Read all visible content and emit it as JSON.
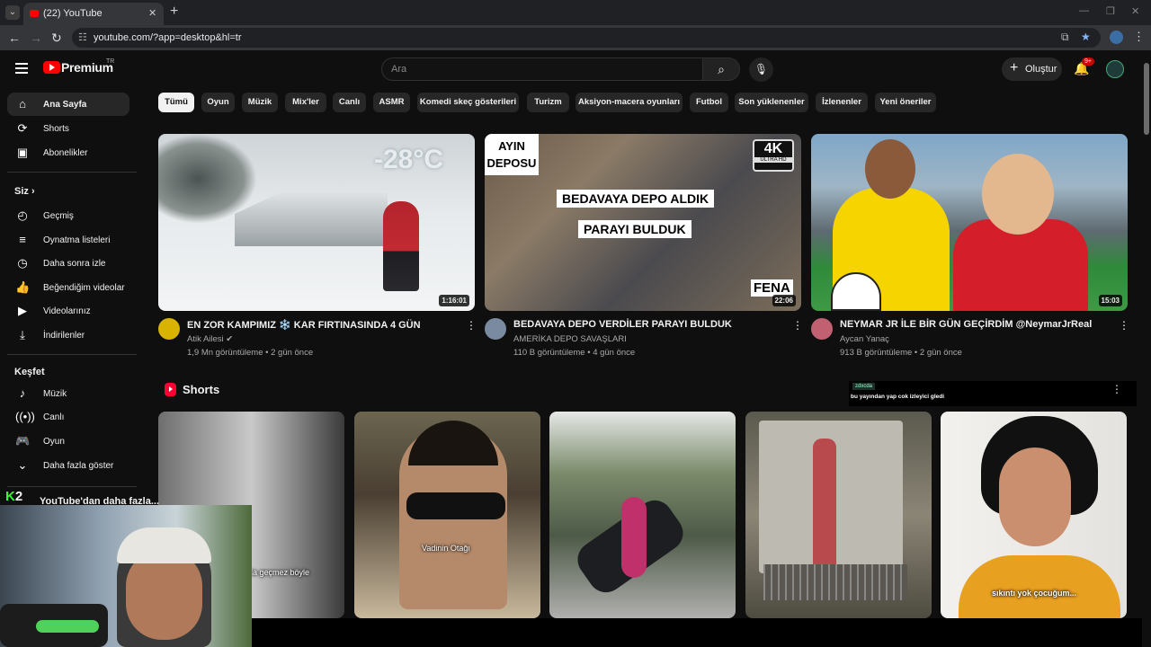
{
  "browser": {
    "tab_title": "(22) YouTube",
    "url": "youtube.com/?app=desktop&hl=tr"
  },
  "header": {
    "logo_text": "Premium",
    "logo_region": "TR",
    "search_placeholder": "Ara",
    "create_label": "Oluştur",
    "notification_count": "9+"
  },
  "sidebar": {
    "main": [
      {
        "label": "Ana Sayfa",
        "icon": "home-icon"
      },
      {
        "label": "Shorts",
        "icon": "shorts-icon"
      },
      {
        "label": "Abonelikler",
        "icon": "subscriptions-icon"
      }
    ],
    "you_heading": "Siz",
    "you": [
      {
        "label": "Geçmiş",
        "icon": "history-icon"
      },
      {
        "label": "Oynatma listeleri",
        "icon": "playlist-icon"
      },
      {
        "label": "Daha sonra izle",
        "icon": "clock-icon"
      },
      {
        "label": "Beğendiğim videolar",
        "icon": "thumb-up-icon"
      },
      {
        "label": "Videolarınız",
        "icon": "video-icon"
      },
      {
        "label": "İndirilenler",
        "icon": "download-icon"
      }
    ],
    "explore_heading": "Keşfet",
    "explore": [
      {
        "label": "Müzik",
        "icon": "music-icon"
      },
      {
        "label": "Canlı",
        "icon": "live-icon"
      },
      {
        "label": "Oyun",
        "icon": "gaming-icon"
      },
      {
        "label": "Daha fazla göster",
        "icon": "chevron-down-icon"
      }
    ],
    "more_from": "YouTube'dan daha fazla..."
  },
  "chips": [
    "Tümü",
    "Oyun",
    "Müzik",
    "Mix'ler",
    "Canlı",
    "ASMR",
    "Komedi skeç gösterileri",
    "Turizm",
    "Aksiyon-macera oyunları",
    "Futbol",
    "Son yüklenenler",
    "İzlenenler",
    "Yeni öneriler"
  ],
  "videos": [
    {
      "title": "EN ZOR KAMPIMIZ ❄️ KAR FIRTINASINDA 4 GÜN",
      "channel": "Atik Ailesi",
      "verified": true,
      "views": "1,9 Mn görüntüleme",
      "age": "2 gün önce",
      "duration": "1:16:01",
      "overlay_text": "-28°C"
    },
    {
      "title": "BEDAVAYA DEPO VERDİLER PARAYI BULDUK",
      "channel": "AMERİKA DEPO SAVAŞLARI",
      "verified": false,
      "views": "110 B görüntüleme",
      "age": "4 gün önce",
      "duration": "22:06",
      "overlay_lines": [
        "AYIN",
        "DEPOSU",
        "BEDAVAYA DEPO ALDIK",
        "PARAYI BULDUK",
        "FENA",
        "4K",
        "ULTRA HD"
      ]
    },
    {
      "title": "NEYMAR JR İLE BİR GÜN GEÇİRDİM @NeymarJrReal",
      "channel": "Aycan Yanaç",
      "verified": false,
      "views": "913 B görüntüleme",
      "age": "2 gün önce",
      "duration": "15:03"
    }
  ],
  "shorts_heading": "Shorts",
  "shorts": [
    {
      "subtitle": "la geçmez böyle"
    },
    {
      "subtitle": "Vadinin Otağı"
    },
    {
      "subtitle": ""
    },
    {
      "subtitle": ""
    },
    {
      "subtitle": "sıkıntı yok çocuğum..."
    }
  ],
  "chat_overlay": {
    "user": "zdxcda",
    "message": "bu yayından yap cok izleyici gledi"
  },
  "stream_logo": {
    "letter": "K",
    "number": "2"
  },
  "colors": {
    "accent": "#ff0000",
    "bg": "#0f0f0f",
    "chip": "#272727"
  }
}
